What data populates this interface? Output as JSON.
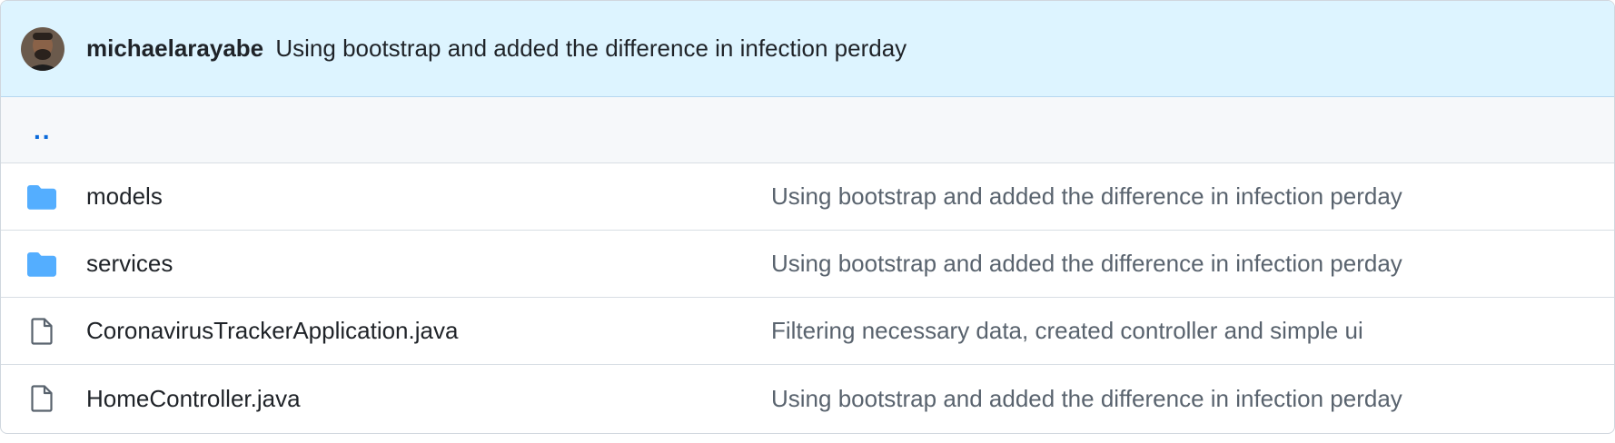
{
  "latest_commit": {
    "author": "michaelarayabe",
    "message": "Using bootstrap and added the difference in infection perday"
  },
  "parent_dir": {
    "label": ".."
  },
  "colors": {
    "header_bg": "#ddf4ff",
    "folder_icon": "#54aeff",
    "link_blue": "#0969da",
    "muted_text": "#59636e"
  },
  "files": [
    {
      "type": "folder",
      "icon": "folder-icon",
      "name": "models",
      "commit": "Using bootstrap and added the difference in infection perday"
    },
    {
      "type": "folder",
      "icon": "folder-icon",
      "name": "services",
      "commit": "Using bootstrap and added the difference in infection perday"
    },
    {
      "type": "file",
      "icon": "file-icon",
      "name": "CoronavirusTrackerApplication.java",
      "commit": "Filtering necessary data, created controller and simple ui"
    },
    {
      "type": "file",
      "icon": "file-icon",
      "name": "HomeController.java",
      "commit": "Using bootstrap and added the difference in infection perday"
    }
  ]
}
